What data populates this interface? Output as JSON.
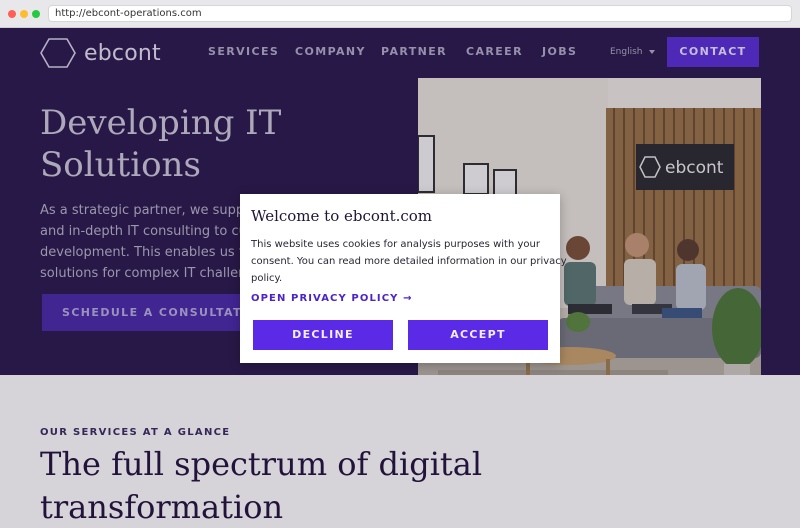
{
  "browser": {
    "url": "http://ebcont-operations.com"
  },
  "header": {
    "logo_text": "ebcont",
    "nav": [
      {
        "label": "SERVICES"
      },
      {
        "label": "COMPANY"
      },
      {
        "label": "PARTNER"
      },
      {
        "label": "CAREER"
      },
      {
        "label": "JOBS"
      }
    ],
    "language": "English",
    "contact_label": "CONTACT"
  },
  "hero": {
    "title_lines": [
      "Developing IT",
      "Solutions"
    ],
    "text_lines": [
      "As a strategic partner, we support",
      "and in-depth IT consulting to cu",
      "development. This enables us to",
      "solutions for complex IT challen"
    ],
    "cta_label": "SCHEDULE A CONSULTATION NOW",
    "photo_sign": "ebcont"
  },
  "services": {
    "kicker": "OUR SERVICES AT A GLANCE",
    "title_lines": [
      "The full spectrum of digital",
      "transformation"
    ]
  },
  "cookie_modal": {
    "title": "Welcome to ebcont.com",
    "body_lines": [
      "This website uses cookies for analysis purposes with your",
      "consent. You can read more detailed information in our privacy",
      "policy."
    ],
    "privacy_link": "OPEN PRIVACY POLICY →",
    "decline_label": "DECLINE",
    "accept_label": "ACCEPT"
  },
  "colors": {
    "hero_bg": "#2a1a4e",
    "brand_purple": "#5b2ae6",
    "link_purple": "#4b24c9"
  }
}
